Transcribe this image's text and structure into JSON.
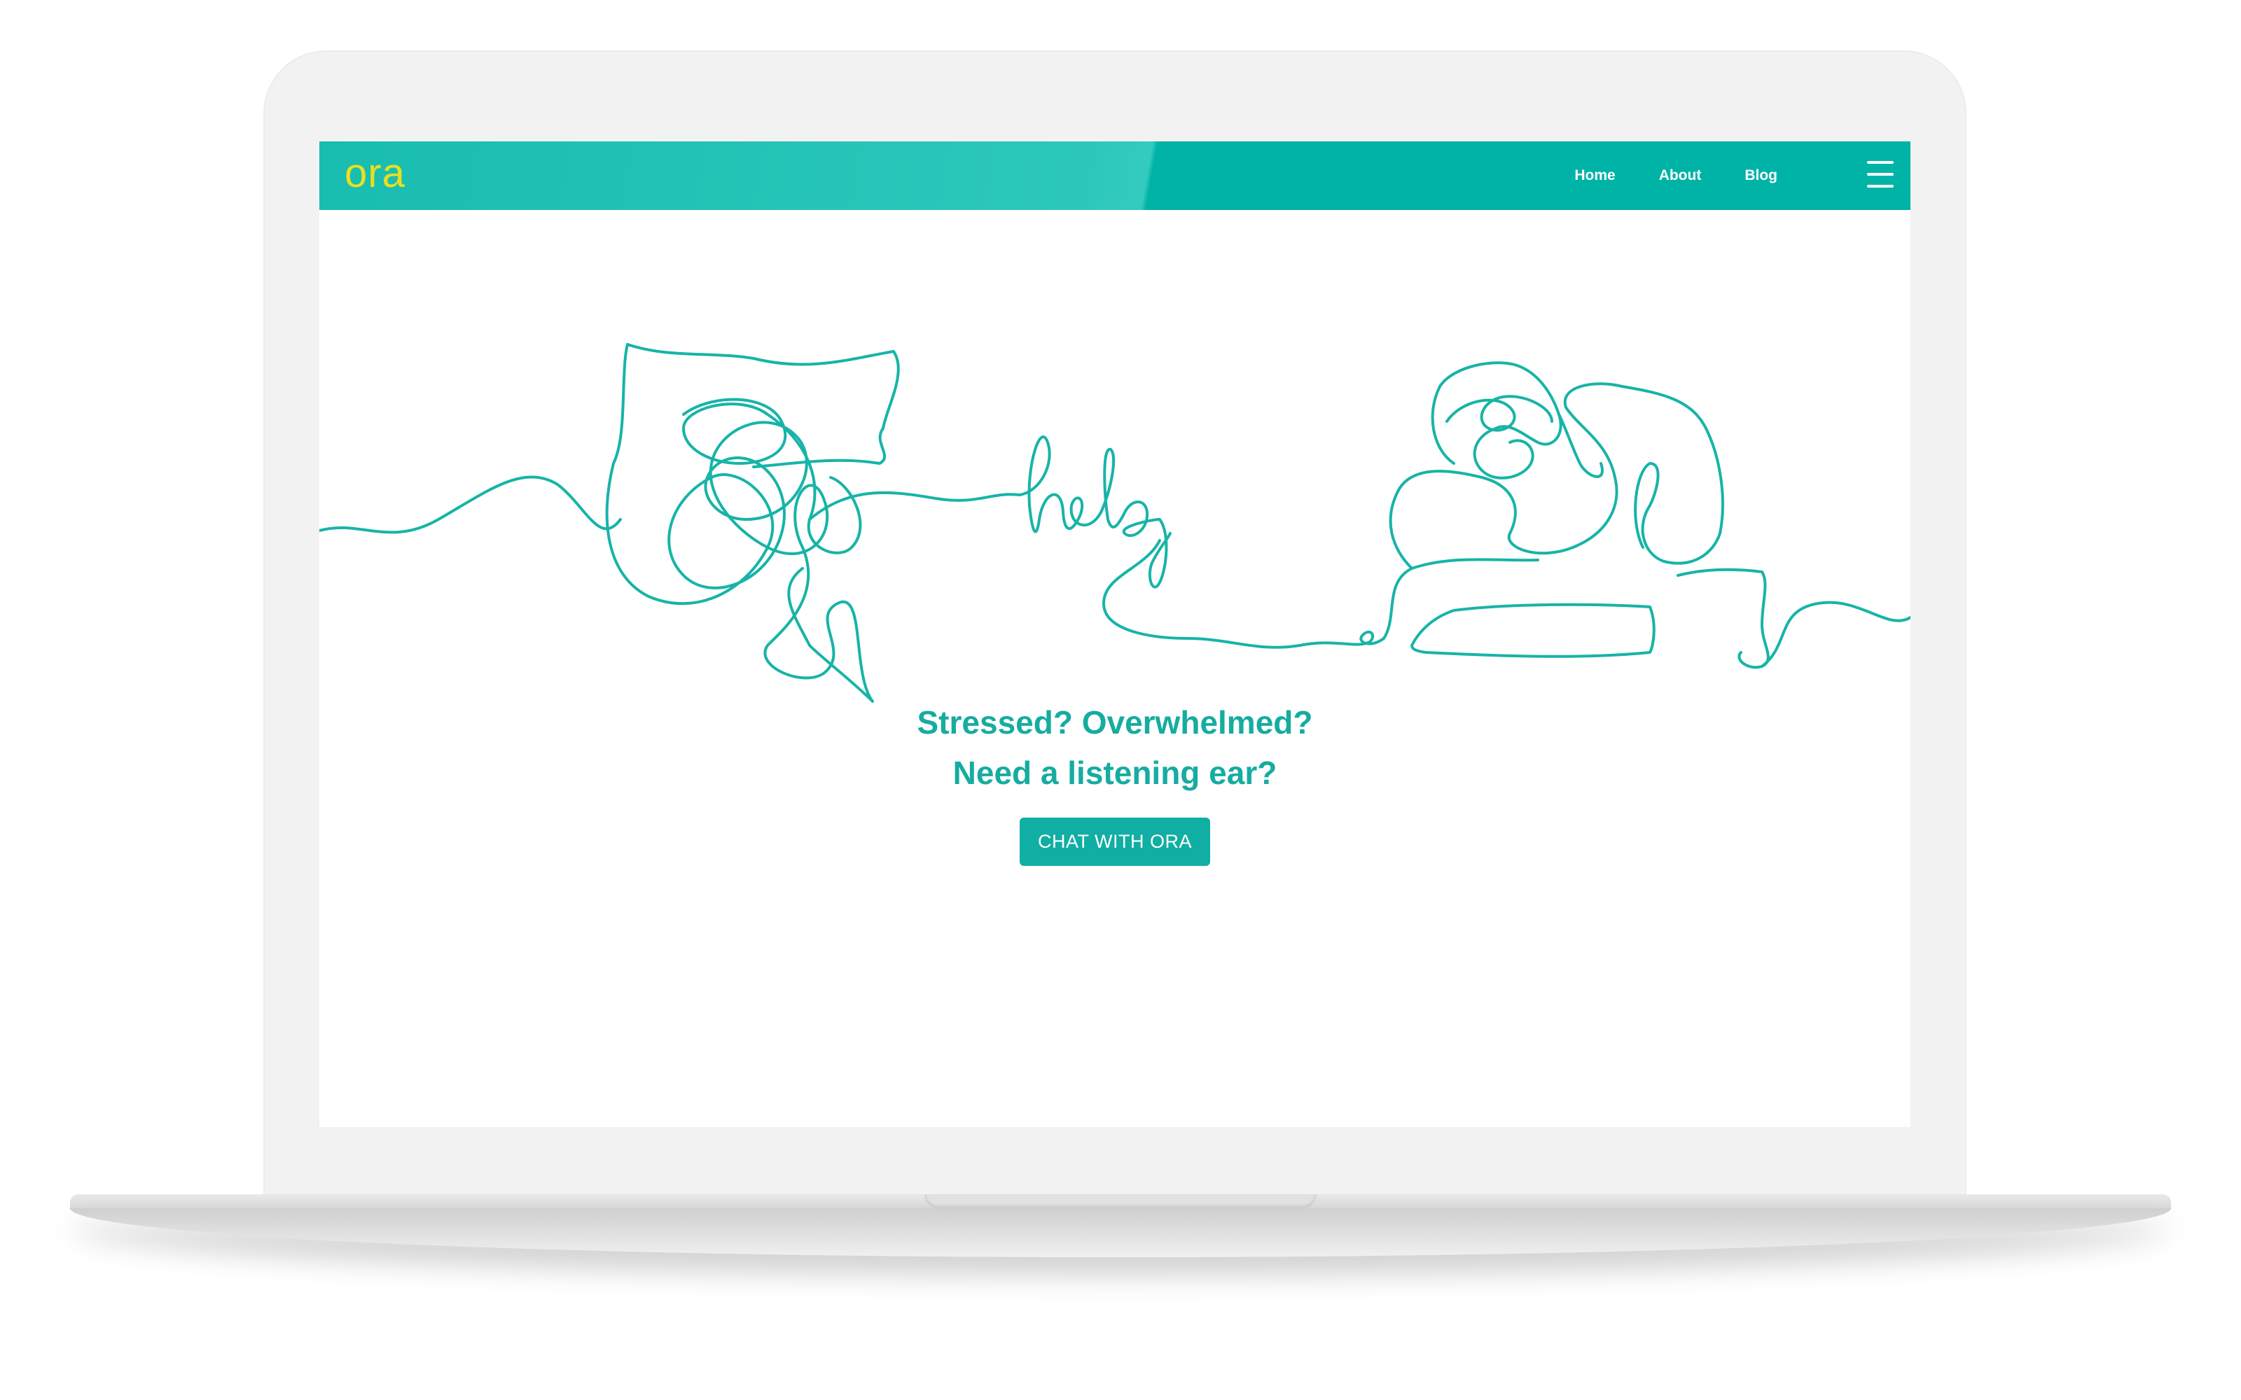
{
  "colors": {
    "brand_teal": "#00b3a7",
    "logo_yellow": "#e8e01f",
    "headline_teal": "#16aca1",
    "line_art": "#17b4a7"
  },
  "header": {
    "logo_text": "ora",
    "nav": [
      {
        "label": "Home"
      },
      {
        "label": "About"
      },
      {
        "label": "Blog"
      }
    ],
    "menu_icon": "hamburger-icon"
  },
  "hero": {
    "illustration_word": "help",
    "headline_line1": "Stressed? Overwhelmed?",
    "headline_line2": "Need a listening ear?",
    "cta_label": "CHAT WITH ORA"
  }
}
